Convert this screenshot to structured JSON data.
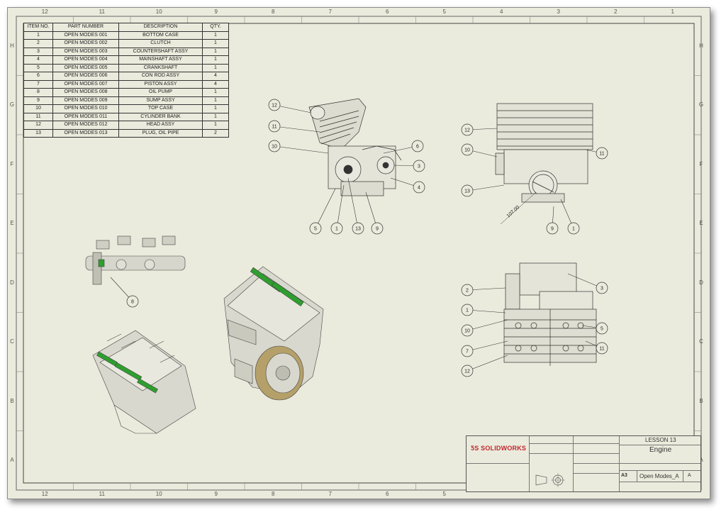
{
  "sheet": {
    "columns_top": [
      "12",
      "11",
      "10",
      "9",
      "8",
      "7",
      "6",
      "5",
      "4",
      "3",
      "2",
      "1"
    ],
    "columns_bottom": [
      "12",
      "11",
      "10",
      "9",
      "8",
      "7",
      "6",
      "5"
    ],
    "rows_left": [
      "H",
      "G",
      "F",
      "E",
      "D",
      "C",
      "B",
      "A"
    ],
    "rows_right": [
      "H",
      "G",
      "F",
      "E",
      "D",
      "C",
      "B",
      "A"
    ]
  },
  "bom": {
    "headers": [
      "ITEM NO.",
      "PART NUMBER",
      "DESCRIPTION",
      "QTY."
    ],
    "rows": [
      [
        "1",
        "OPEN MODES 001",
        "BOTTOM CASE",
        "1"
      ],
      [
        "2",
        "OPEN MODES 002",
        "CLUTCH",
        "1"
      ],
      [
        "3",
        "OPEN MODES 003",
        "COUNTERSHAFT ASSY",
        "1"
      ],
      [
        "4",
        "OPEN MODES 004",
        "MAINSHAFT ASSY",
        "1"
      ],
      [
        "5",
        "OPEN MODES 005",
        "CRANKSHAFT",
        "1"
      ],
      [
        "6",
        "OPEN MODES 006",
        "CON ROD ASSY",
        "4"
      ],
      [
        "7",
        "OPEN MODES 007",
        "PISTON ASSY",
        "4"
      ],
      [
        "8",
        "OPEN MODES 008",
        "OIL PUMP",
        "1"
      ],
      [
        "9",
        "OPEN MODES 009",
        "SUMP ASSY",
        "1"
      ],
      [
        "10",
        "OPEN MODES 010",
        "TOP CASE",
        "1"
      ],
      [
        "11",
        "OPEN MODES 011",
        "CYLINDER BANK",
        "1"
      ],
      [
        "12",
        "OPEN MODES 012",
        "HEAD ASSY",
        "1"
      ],
      [
        "13",
        "OPEN MODES 013",
        "PLUG, OIL PIPE",
        "2"
      ]
    ]
  },
  "views": {
    "side_balloons": [
      "12",
      "11",
      "10",
      "6",
      "3",
      "4",
      "5",
      "1",
      "13",
      "9"
    ],
    "front_balloons": [
      "12",
      "10",
      "13",
      "11",
      "9",
      "1"
    ],
    "front_dimension": "107.00",
    "top_balloons": [
      "2",
      "1",
      "10",
      "7",
      "12",
      "3",
      "5",
      "11"
    ],
    "crank_balloons": [
      "8"
    ]
  },
  "title_block": {
    "logo_prefix": "ƼS",
    "logo_text": "SOLIDWORKS",
    "lesson": "LESSON 13",
    "title": "Engine",
    "size": "A3",
    "dwg_no": "Open Modes_A",
    "rev": "A"
  },
  "colors": {
    "sheet": "#ebebdd",
    "line": "#333333",
    "highlight": "#2e9e2e",
    "brand": "#c0272d"
  }
}
